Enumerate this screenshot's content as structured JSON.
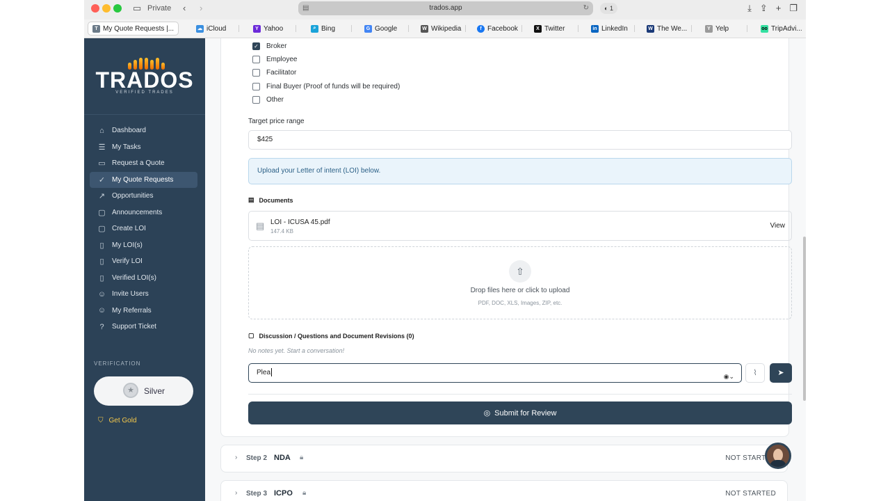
{
  "browser": {
    "private_label": "Private",
    "url": "trados.app",
    "ext_badge": "1",
    "favorites": [
      {
        "label": "My Quote Requests |...",
        "icon": "T",
        "color": "#6b7a88",
        "active": true
      },
      {
        "label": "iCloud",
        "icon": "☁",
        "color": "#3a8fe0"
      },
      {
        "label": "Yahoo",
        "icon": "Y",
        "color": "#6c2bd9"
      },
      {
        "label": "Bing",
        "icon": "⌕",
        "color": "#1aa3d9"
      },
      {
        "label": "Google",
        "icon": "G",
        "color": "#4285f4"
      },
      {
        "label": "Wikipedia",
        "icon": "W",
        "color": "#555555"
      },
      {
        "label": "Facebook",
        "icon": "f",
        "color": "#1877f2"
      },
      {
        "label": "Twitter",
        "icon": "X",
        "color": "#111111"
      },
      {
        "label": "LinkedIn",
        "icon": "in",
        "color": "#0a66c2"
      },
      {
        "label": "The We...",
        "icon": "W",
        "color": "#1b3a78"
      },
      {
        "label": "Yelp",
        "icon": "Y",
        "color": "#9a9a9a"
      },
      {
        "label": "TripAdvi...",
        "icon": "oo",
        "color": "#34e0a1"
      }
    ]
  },
  "sidebar": {
    "logo": "TRADOS",
    "logo_sub": "VERIFIED TRADES",
    "nav": [
      {
        "label": "Dashboard",
        "icon": "⌂"
      },
      {
        "label": "My Tasks",
        "icon": "☰"
      },
      {
        "label": "Request a Quote",
        "icon": "▭"
      },
      {
        "label": "My Quote Requests",
        "icon": "✓",
        "active": true
      },
      {
        "label": "Opportunities",
        "icon": "↗"
      },
      {
        "label": "Announcements",
        "icon": "▢"
      },
      {
        "label": "Create LOI",
        "icon": "▢"
      },
      {
        "label": "My LOI(s)",
        "icon": "▯"
      },
      {
        "label": "Verify LOI",
        "icon": "▯"
      },
      {
        "label": "Verified LOI(s)",
        "icon": "▯"
      },
      {
        "label": "Invite Users",
        "icon": "☺"
      },
      {
        "label": "My Referrals",
        "icon": "☺"
      },
      {
        "label": "Support Ticket",
        "icon": "?"
      }
    ],
    "verification_label": "VERIFICATION",
    "tier": "Silver",
    "get_gold": "Get Gold"
  },
  "form": {
    "roles": [
      {
        "label": "Broker",
        "checked": true
      },
      {
        "label": "Employee",
        "checked": false
      },
      {
        "label": "Facilitator",
        "checked": false
      },
      {
        "label": "Final Buyer (Proof of funds will be required)",
        "checked": false
      },
      {
        "label": "Other",
        "checked": false
      }
    ],
    "target_price_label": "Target price range",
    "target_price_value": "$425",
    "info_text": "Upload your Letter of intent (LOI) below.",
    "documents_heading": "Documents",
    "file": {
      "name": "LOI - ICUSA 45.pdf",
      "size": "147.4 KB",
      "action": "View"
    },
    "dropzone": {
      "title": "Drop files here or click to upload",
      "subtitle": "PDF, DOC, XLS, Images, ZIP, etc."
    },
    "discussion_heading": "Discussion / Questions and Document Revisions (0)",
    "no_notes": "No notes yet. Start a conversation!",
    "message_value": "Plea",
    "submit_label": "Submit for Review"
  },
  "steps": [
    {
      "num": "Step 2",
      "name": "NDA",
      "status": "NOT STARTED"
    },
    {
      "num": "Step 3",
      "name": "ICPO",
      "status": "NOT STARTED"
    }
  ]
}
